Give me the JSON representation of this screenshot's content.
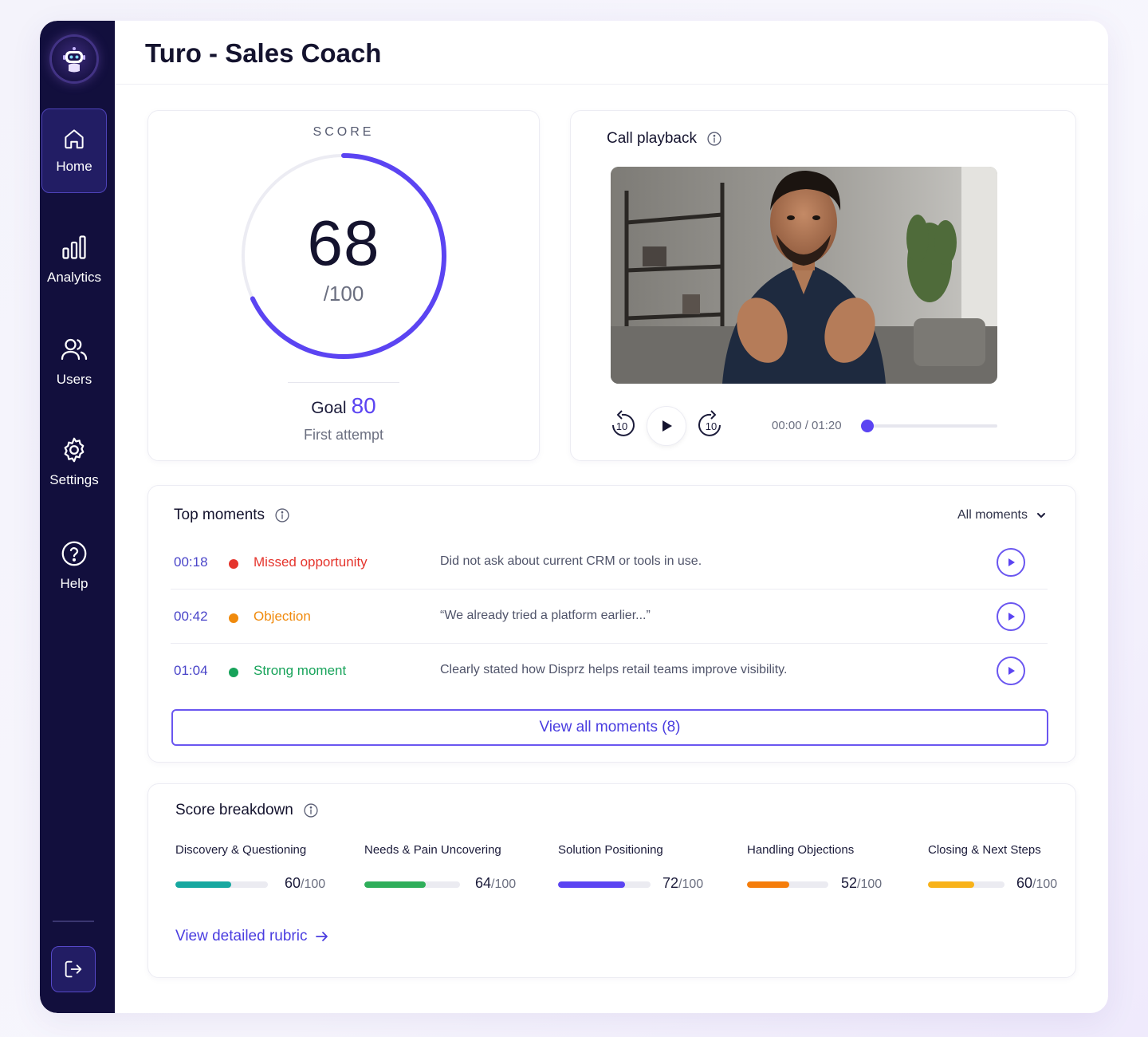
{
  "app": {
    "title": "Turo - Sales Coach"
  },
  "sidebar": {
    "items": [
      {
        "label": "Home",
        "icon": "home-icon",
        "active": true
      },
      {
        "label": "Analytics",
        "icon": "bar-chart-icon",
        "active": false
      },
      {
        "label": "Users",
        "icon": "users-icon",
        "active": false
      },
      {
        "label": "Settings",
        "icon": "gear-icon",
        "active": false
      },
      {
        "label": "Help",
        "icon": "help-icon",
        "active": false
      }
    ],
    "logout_icon": "logout-icon"
  },
  "score": {
    "label": "SCORE",
    "value": "68",
    "max": "/100",
    "progress": 0.68,
    "goal_label": "Goal",
    "goal_value": "80",
    "attempt": "First attempt",
    "accent": "#5b44f2"
  },
  "playback": {
    "title": "Call playback",
    "info_icon": "info-icon",
    "rewind_label": "10",
    "forward_label": "10",
    "time": "00:00 / 01:20",
    "position": 0
  },
  "moments": {
    "title": "Top moments",
    "filter": "All moments",
    "items": [
      {
        "time": "00:18",
        "type": "Missed opportunity",
        "color": "#e5352d",
        "desc": "Did not ask about current CRM or tools in use."
      },
      {
        "time": "00:42",
        "type": "Objection",
        "color": "#f08a0c",
        "desc": "“We already tried a platform earlier...”"
      },
      {
        "time": "01:04",
        "type": "Strong moment",
        "color": "#17a35a",
        "desc": "Clearly stated how Disprz helps retail teams improve visibility."
      }
    ],
    "view_all": "View all moments (8)"
  },
  "breakdown": {
    "title": "Score breakdown",
    "metrics": [
      {
        "label": "Discovery & Questioning",
        "score": "60",
        "den": "/100",
        "value": 60,
        "color": "#17a8a0"
      },
      {
        "label": "Needs & Pain Uncovering",
        "score": "64",
        "den": "/100",
        "value": 64,
        "color": "#2fae5a"
      },
      {
        "label": "Solution Positioning",
        "score": "72",
        "den": "/100",
        "value": 72,
        "color": "#5b44f2"
      },
      {
        "label": "Handling Objections",
        "score": "52",
        "den": "/100",
        "value": 52,
        "color": "#f57d0a"
      },
      {
        "label": "Closing & Next Steps",
        "score": "60",
        "den": "/100",
        "value": 60,
        "color": "#f8b219"
      }
    ],
    "rubric_link": "View detailed rubric"
  }
}
